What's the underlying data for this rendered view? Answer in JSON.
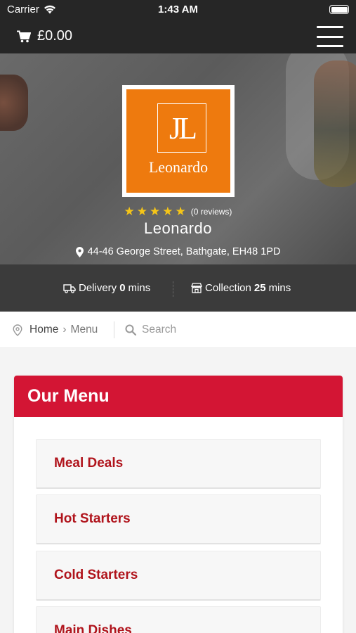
{
  "status": {
    "carrier": "Carrier",
    "time": "1:43 AM"
  },
  "header": {
    "cart_total": "£0.00",
    "cart_icon": "cart-icon",
    "menu_icon": "hamburger-menu-icon"
  },
  "restaurant": {
    "logo_monogram": "JL",
    "logo_text": "Leonardo",
    "name": "Leonardo",
    "rating_stars": 5,
    "reviews": "(0 reviews)",
    "address": "44-46 George Street, Bathgate, EH48 1PD"
  },
  "times": {
    "delivery_label": "Delivery",
    "delivery_value": "0",
    "delivery_unit": "mins",
    "collection_label": "Collection",
    "collection_value": "25",
    "collection_unit": "mins"
  },
  "breadcrumb": {
    "home": "Home",
    "separator": "›",
    "current": "Menu",
    "search_placeholder": "Search"
  },
  "menu": {
    "title": "Our Menu",
    "categories": [
      {
        "label": "Meal Deals"
      },
      {
        "label": "Hot Starters"
      },
      {
        "label": "Cold Starters"
      },
      {
        "label": "Main Dishes"
      }
    ]
  },
  "colors": {
    "header_bg": "#262626",
    "accent_red": "#d31534",
    "category_text": "#b0141c",
    "logo_orange": "#ee7a0e",
    "star_yellow": "#f5c518"
  }
}
